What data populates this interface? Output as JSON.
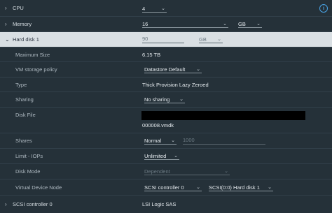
{
  "cpu": {
    "label": "CPU",
    "value": "4"
  },
  "memory": {
    "label": "Memory",
    "value": "16",
    "unit": "GB"
  },
  "hard_disk": {
    "label": "Hard disk 1",
    "value": "90",
    "unit": "GB"
  },
  "max_size": {
    "label": "Maximum Size",
    "value": "6.15 TB"
  },
  "storage_policy": {
    "label": "VM storage policy",
    "value": "Datastore Default"
  },
  "type": {
    "label": "Type",
    "value": "Thick Provision Lazy Zeroed"
  },
  "sharing": {
    "label": "Sharing",
    "value": "No sharing"
  },
  "disk_file": {
    "label": "Disk File",
    "value": "000008.vmdk"
  },
  "shares": {
    "label": "Shares",
    "level": "Normal",
    "value": "1000"
  },
  "limit_iops": {
    "label": "Limit - IOPs",
    "value": "Unlimited"
  },
  "disk_mode": {
    "label": "Disk Mode",
    "value": "Dependent"
  },
  "vdn": {
    "label": "Virtual Device Node",
    "controller": "SCSI controller 0",
    "slot": "SCSI(0:0) Hard disk 1"
  },
  "scsi": {
    "label": "SCSI controller 0",
    "value": "LSI Logic SAS"
  },
  "info_icon_glyph": "i",
  "colors": {
    "background": "#253139",
    "header_bg": "#d9dfe3",
    "info": "#49a4e6"
  }
}
